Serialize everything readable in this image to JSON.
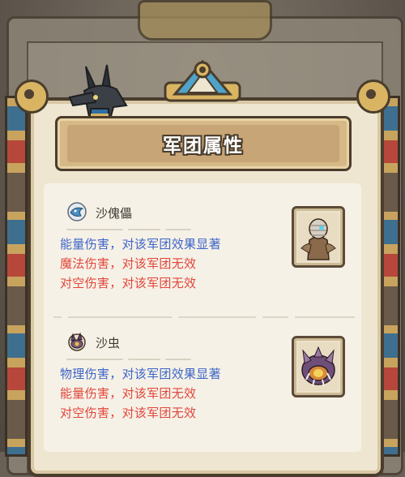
{
  "header": {
    "title": "军团属性"
  },
  "colors": {
    "positive": "#3c65c9",
    "negative": "#e2453c",
    "name": "#3f3a35"
  },
  "units": [
    {
      "name": "沙傀儡",
      "icon": "sand-golem-icon",
      "portrait": "sand-golem-portrait",
      "effects": [
        {
          "text": "能量伤害，对该军团效果显著",
          "type": "positive"
        },
        {
          "text": "魔法伤害，对该军团无效",
          "type": "negative"
        },
        {
          "text": "对空伤害，对该军团无效",
          "type": "negative"
        }
      ]
    },
    {
      "name": "沙虫",
      "icon": "sandworm-icon",
      "portrait": "sandworm-portrait",
      "effects": [
        {
          "text": "物理伤害，对该军团效果显著",
          "type": "positive"
        },
        {
          "text": "能量伤害，对该军团无效",
          "type": "negative"
        },
        {
          "text": "对空伤害，对该军团无效",
          "type": "negative"
        }
      ]
    }
  ]
}
